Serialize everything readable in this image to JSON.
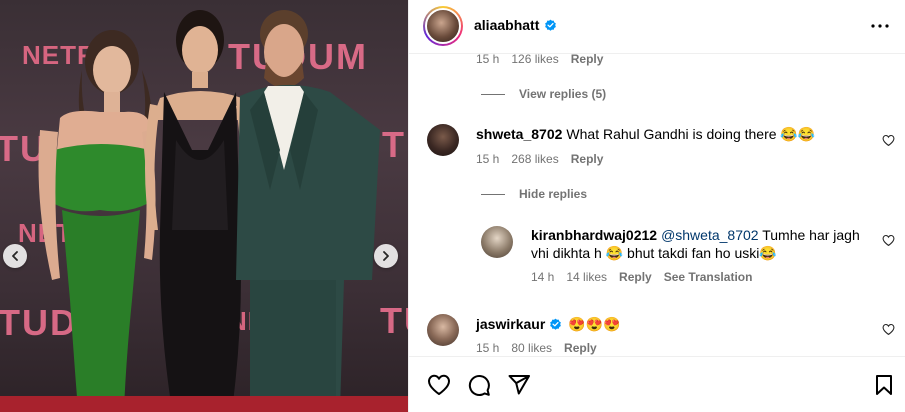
{
  "post": {
    "photo": {
      "wall_text_netflix": "NETFLIX",
      "wall_text_netflix_partial": "NET",
      "wall_text_tudum": "TUDUM",
      "wall_text_tudum_partial": "TUDU",
      "wall_text_tu": "TU",
      "wall_text_net_partial": "NE",
      "wall_text_tud": "TUD"
    }
  },
  "header": {
    "username": "aliaabhatt",
    "verified_icon": "verified-badge-icon",
    "more_icon": "more-options-icon"
  },
  "comments": {
    "prev": {
      "time": "15 h",
      "likes": "126 likes",
      "reply": "Reply"
    },
    "view_replies": "View replies (5)",
    "c1": {
      "username": "shweta_8702",
      "text": "What Rahul Gandhi is doing there 😂😂",
      "time": "15 h",
      "likes": "268 likes",
      "reply": "Reply"
    },
    "hide_replies": "Hide replies",
    "r1": {
      "username": "kiranbhardwaj0212",
      "mention": "@shweta_8702",
      "text_line1": "Tumhe har jagh",
      "text_line2": "vhi dikhta h 😂 bhut takdi fan ho uski😂",
      "time": "14 h",
      "likes": "14 likes",
      "reply": "Reply",
      "translate": "See Translation"
    },
    "c2": {
      "username": "jaswirkaur",
      "text": "😍😍😍",
      "time": "15 h",
      "likes": "80 likes",
      "reply": "Reply"
    }
  },
  "actions": {
    "like_icon": "heart-icon",
    "comment_icon": "comment-icon",
    "share_icon": "share-icon",
    "save_icon": "bookmark-icon"
  },
  "colors": {
    "accent_link": "#00376b",
    "verified": "#0095f6",
    "muted": "#737373",
    "wall_text": "#e56f8d"
  }
}
